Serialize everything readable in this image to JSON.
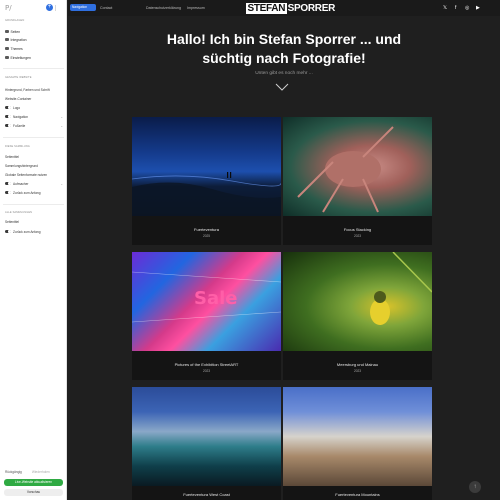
{
  "sidebar": {
    "logo": "P/",
    "add_label": "+",
    "sections": {
      "general": "Grundlagen",
      "website_style": "Gesamte Website",
      "page": "Diese Sammlung",
      "all_collections": "Alle Sammlungen"
    },
    "nav": [
      {
        "label": "Seiten",
        "icon": "pages-icon"
      },
      {
        "label": "Integration",
        "icon": "integration-icon"
      },
      {
        "label": "Themes",
        "icon": "themes-icon"
      },
      {
        "label": "Einstellungen",
        "icon": "gear-icon"
      }
    ],
    "style_items": {
      "bg_fonts": "Hintergrund, Farben und Schrift",
      "container": "Website-Container"
    },
    "style_toggles": [
      "Logo",
      "Navigation",
      "Fußzeile"
    ],
    "collection_items": {
      "selected": "Seitentitel",
      "bg": "Sammlungshintergrund",
      "formats": "Globale Seitenformate nutzen"
    },
    "collection_toggles": [
      "Aufmacher",
      "Zurück zum Anfang"
    ],
    "all_items": {
      "selected": "Seitentitel"
    },
    "all_toggles": [
      "Zurück zum Anfang"
    ],
    "undo": "Rückgängig",
    "redo": "Wiederholen",
    "publish": "Live-Website aktualisieren",
    "preview": "Vorschau"
  },
  "site": {
    "nav_pill": "Navigation",
    "nav_links": [
      "Contact",
      "Datenschutzerklärung",
      "Impressum"
    ],
    "brand_a": "STEFAN",
    "brand_b": "SPORRER",
    "social": [
      "𝕏",
      "f",
      "◎",
      "▶"
    ],
    "hero_title_1": "Hallo! Ich bin Stefan Sporrer ... und",
    "hero_title_2": "süchtig nach Fotografie!",
    "hero_sub": "Unten gibt es noch mehr ...",
    "cards": [
      {
        "title": "Fuerteventura",
        "year": "2025"
      },
      {
        "title": "Focus Stacking",
        "year": "2023"
      },
      {
        "title": "Pictures of the Exhibition StreetART",
        "year": "2023"
      },
      {
        "title": "Meersburg und Mainau",
        "year": "2023"
      },
      {
        "title": "Fuerteventura West Coast",
        "year": ""
      },
      {
        "title": "Fuerteventura Mountains",
        "year": ""
      }
    ],
    "sale_text": "Sale",
    "scroll_top": "↑"
  },
  "colors": {
    "accent": "#2f6fe0",
    "publish": "#2faa43",
    "site_bg": "#1f1f1f"
  }
}
